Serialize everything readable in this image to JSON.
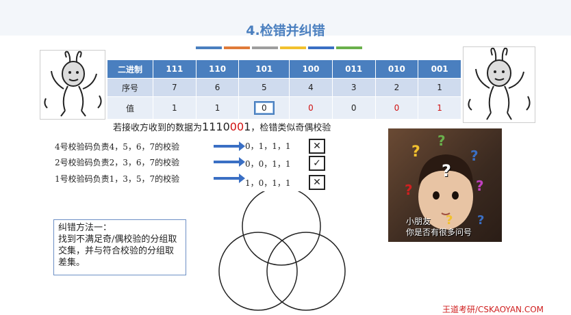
{
  "title": "4.检错并纠错",
  "accent_colors": [
    "#4a7fbf",
    "#e07b39",
    "#9e9e9e",
    "#f2c12e",
    "#3a6fc4",
    "#6ab04c"
  ],
  "table": {
    "rows": [
      {
        "label": "二进制",
        "cells": [
          "111",
          "110",
          "101",
          "100",
          "011",
          "010",
          "001"
        ]
      },
      {
        "label": "序号",
        "cells": [
          "7",
          "6",
          "5",
          "4",
          "3",
          "2",
          "1"
        ]
      },
      {
        "label": "值",
        "cells": [
          "1",
          "1",
          "0",
          "0",
          "0",
          "0",
          "1"
        ]
      }
    ]
  },
  "received": {
    "prefix": "若接收方收到的数据为",
    "digits": [
      "1",
      "1",
      "1",
      "0",
      "0",
      "0",
      "1"
    ],
    "suffix": "，检错类似奇偶校验"
  },
  "checks": [
    {
      "text": "4号校验码负责4，5，6，7的校验",
      "bits": "0，1，1，1",
      "result": "✕"
    },
    {
      "text": "2号校验码负责2，3，6，7的校验",
      "bits": "0，0，1，1",
      "result": "✓"
    },
    {
      "text": "1号校验码负责1，3，5，7的校验",
      "bits": "1，0，1，1",
      "result": "✕"
    }
  ],
  "method": {
    "line1": "纠错方法一：",
    "line2": "找到不满足奇/偶校验的分组取交集，并与符合校验的分组取差集。"
  },
  "photo_caption": {
    "line1": "小朋友",
    "line2": "你是否有很多问号"
  },
  "footer": "王道考研/CSKAOYAN.COM"
}
